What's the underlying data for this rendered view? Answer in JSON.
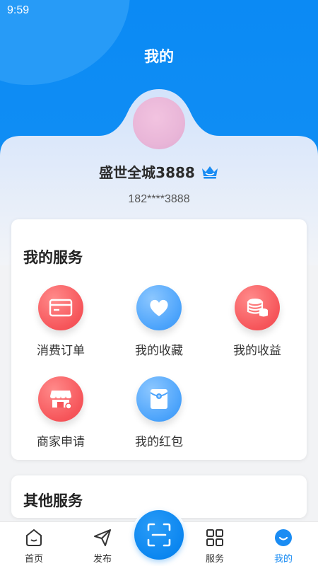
{
  "status_bar": {
    "time": "9:59"
  },
  "header": {
    "title": "我的"
  },
  "profile": {
    "name": "盛世全城3888",
    "phone": "182****3888",
    "badge_icon": "crown-icon"
  },
  "my_services": {
    "title": "我的服务",
    "items": [
      {
        "label": "消费订单",
        "icon": "card-icon",
        "color": "red"
      },
      {
        "label": "我的收藏",
        "icon": "heart-icon",
        "color": "blue"
      },
      {
        "label": "我的收益",
        "icon": "coins-icon",
        "color": "red"
      },
      {
        "label": "商家申请",
        "icon": "shop-icon",
        "color": "red"
      },
      {
        "label": "我的红包",
        "icon": "red-envelope-icon",
        "color": "blue"
      }
    ]
  },
  "other_services": {
    "title": "其他服务"
  },
  "bottom_nav": {
    "items": [
      {
        "label": "首页",
        "icon": "home-icon"
      },
      {
        "label": "发布",
        "icon": "send-icon"
      },
      {
        "label": "服务",
        "icon": "grid-icon"
      },
      {
        "label": "我的",
        "icon": "profile-smile-icon",
        "active": true
      }
    ],
    "scan_icon": "scan-icon"
  },
  "colors": {
    "primary": "#0b8af4",
    "accent_red": "#f6555a",
    "accent_blue": "#4ba3fb",
    "active_nav": "#1a8cf3"
  }
}
